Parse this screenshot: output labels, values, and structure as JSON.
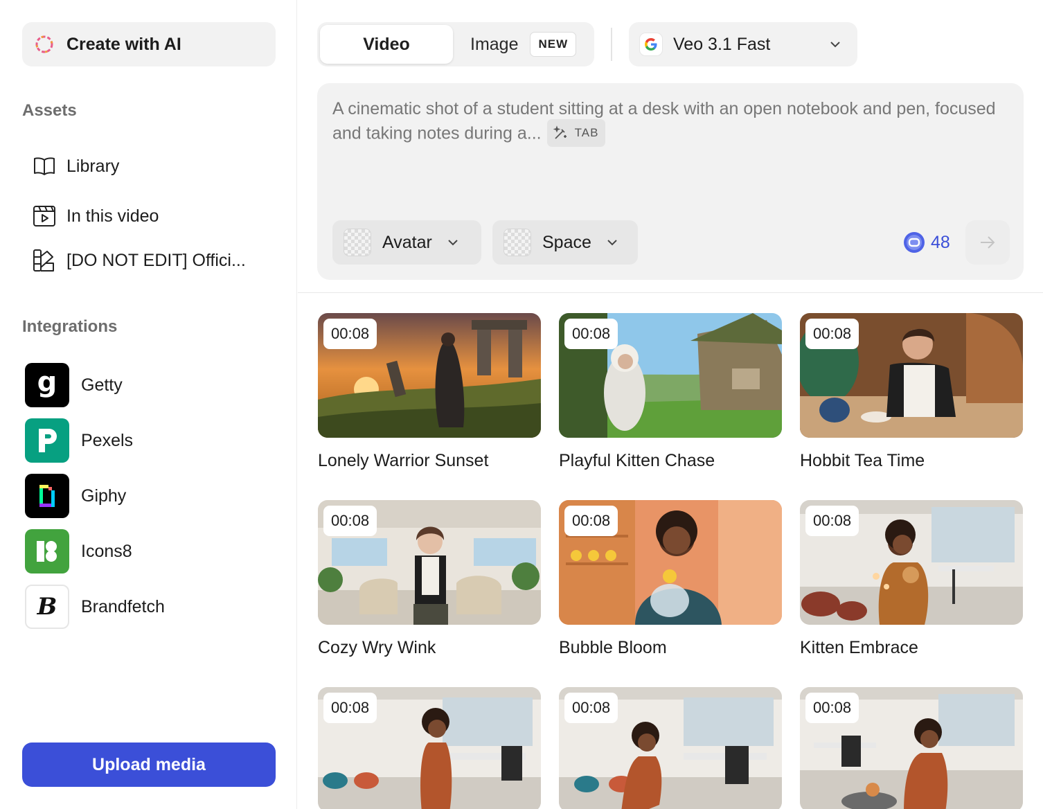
{
  "sidebar": {
    "create_label": "Create with AI",
    "assets_title": "Assets",
    "assets": [
      {
        "label": "Library",
        "icon": "book-icon"
      },
      {
        "label": "In this video",
        "icon": "video-clip-icon"
      },
      {
        "label": "[DO NOT EDIT] Offici...",
        "icon": "brand-kit-icon"
      }
    ],
    "integrations_title": "Integrations",
    "integrations": [
      {
        "label": "Getty",
        "icon": "getty-logo"
      },
      {
        "label": "Pexels",
        "icon": "pexels-logo"
      },
      {
        "label": "Giphy",
        "icon": "giphy-logo"
      },
      {
        "label": "Icons8",
        "icon": "icons8-logo"
      },
      {
        "label": "Brandfetch",
        "icon": "brandfetch-logo"
      }
    ],
    "upload_label": "Upload media"
  },
  "toolbar": {
    "tab_video": "Video",
    "tab_image": "Image",
    "tab_image_badge": "NEW",
    "model": "Veo 3.1 Fast"
  },
  "prompt": {
    "text": "A cinematic shot of a student sitting at a desk with an open notebook and pen, focused and taking notes during a...",
    "tab_hint": "TAB",
    "avatar_label": "Avatar",
    "space_label": "Space",
    "credits": "48"
  },
  "gallery": [
    {
      "duration": "00:08",
      "title": "Lonely Warrior Sunset"
    },
    {
      "duration": "00:08",
      "title": "Playful Kitten Chase"
    },
    {
      "duration": "00:08",
      "title": "Hobbit Tea Time"
    },
    {
      "duration": "00:08",
      "title": "Cozy Wry Wink"
    },
    {
      "duration": "00:08",
      "title": "Bubble Bloom"
    },
    {
      "duration": "00:08",
      "title": "Kitten Embrace"
    },
    {
      "duration": "00:08",
      "title": ""
    },
    {
      "duration": "00:08",
      "title": ""
    },
    {
      "duration": "00:08",
      "title": ""
    }
  ],
  "colors": {
    "accent": "#3b4fd8",
    "panel": "#f2f2f2"
  }
}
